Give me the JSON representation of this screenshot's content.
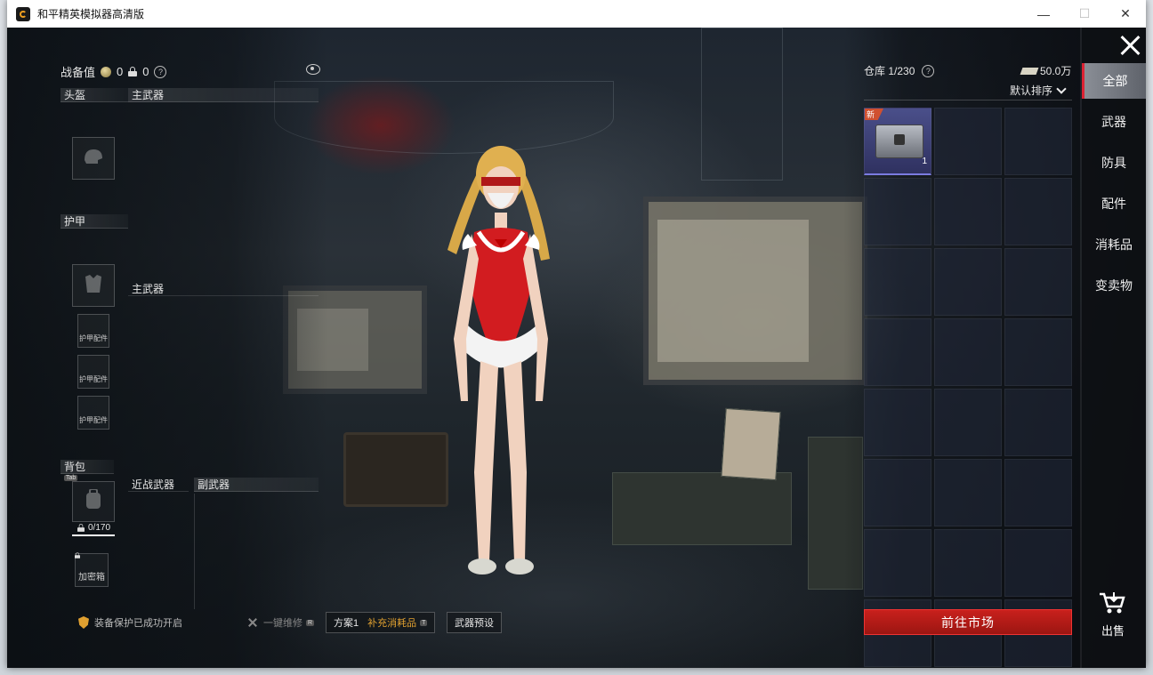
{
  "window": {
    "title": "和平精英模拟器高清版",
    "minimize": "—",
    "maximize": "☐",
    "close": "✕"
  },
  "left": {
    "combat_label": "战备值",
    "combat_value": "0",
    "lock_value": "0",
    "help": "?",
    "helmet": "头盔",
    "primary_1": "主武器",
    "armor": "护甲",
    "primary_2": "主武器",
    "armor_parts": [
      "护甲配件",
      "护甲配件",
      "护甲配件"
    ],
    "backpack": "背包",
    "tab_tag": "Tab",
    "melee": "近战武器",
    "secondary": "副武器",
    "capacity": "0/170",
    "safe_box": "加密箱"
  },
  "bottom": {
    "protect": "装备保护已成功开启",
    "repair": "一键维修",
    "repair_tag": "R",
    "plan": "方案1",
    "restock": "补充消耗品",
    "restock_tag": "T",
    "weapon_preset": "武器预设"
  },
  "warehouse": {
    "title": "仓库 1/230",
    "help": "?",
    "currency": "50.0万",
    "sort": "默认排序",
    "items": [
      {
        "badge": "新",
        "qty": "1",
        "icon": "supply-box-icon"
      }
    ],
    "total_cells": 24,
    "market_button": "前往市场"
  },
  "categories": [
    "全部",
    "武器",
    "防具",
    "配件",
    "消耗品",
    "变卖物"
  ],
  "sell": "出售",
  "colors": {
    "accent_red": "#c8201c",
    "rare_purple": "#4a4f8a",
    "warn_orange": "#e0a030"
  }
}
